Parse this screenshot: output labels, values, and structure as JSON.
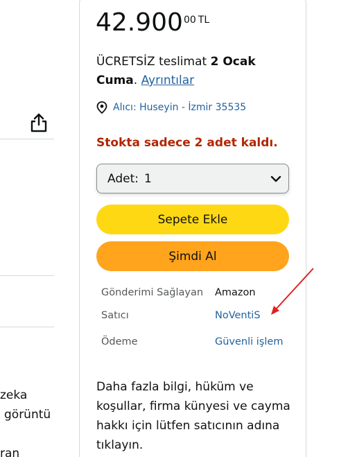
{
  "price": {
    "whole": "42.900",
    "fraction": "00",
    "currency": "TL"
  },
  "delivery": {
    "prefix": "ÜCRETSİZ teslimat ",
    "date": "2 Ocak Cuma",
    "suffix": ". ",
    "details_link": "Ayrıntılar"
  },
  "location": {
    "text": "Alıcı: Huseyin - İzmir 35535"
  },
  "stock_message": "Stokta sadece 2 adet kaldı.",
  "quantity": {
    "label": "Adet:",
    "value": "1"
  },
  "buttons": {
    "add_to_cart": "Sepete Ekle",
    "buy_now": "Şimdi Al"
  },
  "seller_info": [
    {
      "label": "Gönderimi Sağlayan",
      "value": "Amazon"
    },
    {
      "label": "Satıcı",
      "value": "NoVentiS"
    },
    {
      "label": "Ödeme",
      "value": "Güvenli işlem"
    }
  ],
  "more_info_text": "Daha fazla bilgi, hüküm ve koşullar, firma künyesi ve cayma hakkı için lütfen satıcının adına tıklayın.",
  "left_fragments": [
    "zeka",
    "görüntü",
    "ran"
  ],
  "colors": {
    "stock_red": "#b12704",
    "link_blue": "#2162a1",
    "cart_yellow": "#ffd814",
    "buy_orange": "#ffa41c",
    "annotation_red": "#e02020"
  }
}
